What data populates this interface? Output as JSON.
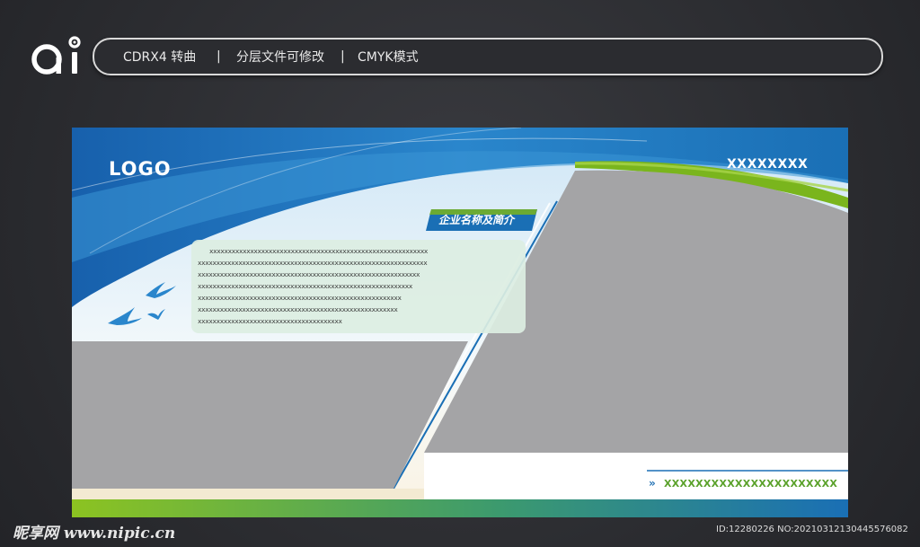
{
  "header": {
    "logo_text": "ai",
    "items": [
      "CDRX4 转曲",
      "分层文件可修改",
      "CMYK模式"
    ],
    "separator": "|"
  },
  "board": {
    "logo": "LOGO",
    "top_right": "XXXXXXXX",
    "company_tag": "企业名称及简介",
    "text_lines": [
      "xxxxxxxxxxxxxxxxxxxxxxxxxxxxxxxxxxxxxxxxxxxxxxxxxxxxxxxxxxx",
      "xxxxxxxxxxxxxxxxxxxxxxxxxxxxxxxxxxxxxxxxxxxxxxxxxxxxxxxxxxxxxx",
      "xxxxxxxxxxxxxxxxxxxxxxxxxxxxxxxxxxxxxxxxxxxxxxxxxxxxxxxxxxxx",
      "xxxxxxxxxxxxxxxxxxxxxxxxxxxxxxxxxxxxxxxxxxxxxxxxxxxxxxxxxx",
      "xxxxxxxxxxxxxxxxxxxxxxxxxxxxxxxxxxxxxxxxxxxxxxxxxxxxxxx",
      "xxxxxxxxxxxxxxxxxxxxxxxxxxxxxxxxxxxxxxxxxxxxxxxxxxxxxx",
      "xxxxxxxxxxxxxxxxxxxxxxxxxxxxxxxxxxxxxxx"
    ],
    "bottom_chevron": "»",
    "bottom_text": "XXXXXXXXXXXXXXXXXXXXXX",
    "colors": {
      "blue": "#1a6fb5",
      "green": "#7ab51d",
      "gray": "#a4a4a6"
    }
  },
  "footer": {
    "watermark": "昵享网 www.nipic.cn",
    "id_text": "ID:12280226 NO:20210312130445576082"
  }
}
